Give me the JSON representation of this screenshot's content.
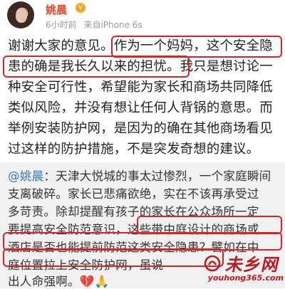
{
  "post": {
    "author": "姚晨",
    "time": "6小时前",
    "source": "来自iPhone 6s",
    "lines": [
      "谢谢大家的意见。作为一个妈妈，这个安全隐",
      "患的确是我长久以来的担忧。我只是想讨论一",
      "种安全可行性，希望能为家长和商场共同降低",
      "类似风险，并没有想让任何人背锅的意思。而",
      "举例安装防护网，是因为的确在其他商场看见",
      "过这样的防护措施，不是突发奇想的建议。"
    ]
  },
  "repost": {
    "mention": "@姚晨",
    "lines": [
      "：天津大悦城的事太过惨烈，一个家庭瞬间",
      "支离破碎。家长已悲痛欲绝，实在不该再承受过",
      "多苛责。除却提醒有孩子的家长在公众场所一定",
      "要提高安全防范意识，这些带中庭设计的商场或",
      "酒店是否也能提前防范这类安全隐患？譬如在中",
      "庭位置拉上安全防护网，虽说",
      "出人命强啊。"
    ],
    "emoji_broken_heart": "💔",
    "emoji_pray": "🙏"
  },
  "watermark": {
    "tag": "未乡网",
    "url": "youhong365.com"
  },
  "colors": {
    "accent": "#e8452d",
    "highlight_border": "#d8232a",
    "mention": "#3478c0",
    "repost_bg": "#f1f1f1"
  }
}
